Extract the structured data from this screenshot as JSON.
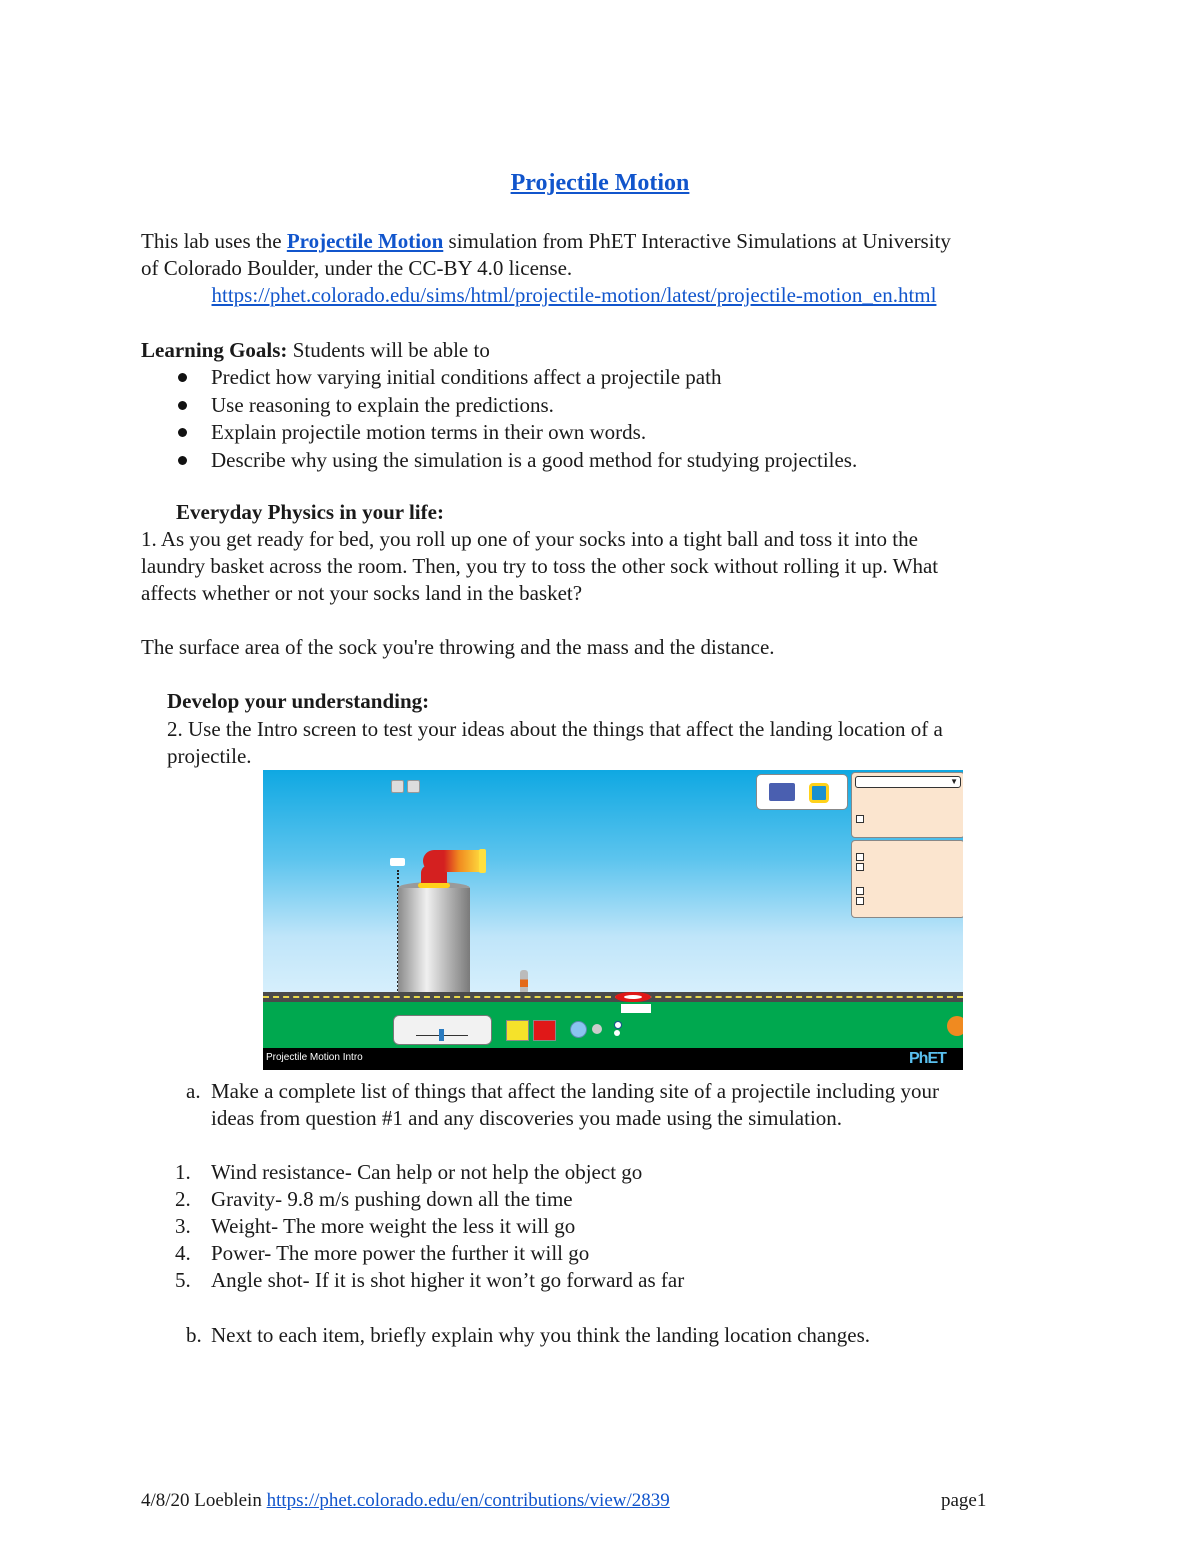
{
  "document": {
    "title": "Projectile Motion",
    "intro": {
      "prefix": "This lab uses the ",
      "link_text": "Projectile Motion",
      "suffix": " simulation from PhET Interactive Simulations at University",
      "line2": "of Colorado Boulder, under the CC-BY 4.0 license.",
      "url": "https://phet.colorado.edu/sims/html/projectile-motion/latest/projectile-motion_en.html"
    },
    "learning_goals": {
      "label": "Learning Goals:",
      "lead": " Students will be able to",
      "items": [
        "Predict how varying initial conditions affect a projectile path",
        "Use reasoning to explain the predictions.",
        "Explain projectile motion terms in their own words.",
        "Describe why using the simulation is a good method for studying projectiles."
      ]
    },
    "everyday": {
      "heading": "Everyday Physics in your life:",
      "question_lines": [
        "1. As you get ready for bed, you roll up one of your socks into a tight ball and toss it into the",
        "laundry basket across the room. Then, you try to toss the other sock without rolling it up. What",
        "affects whether or not your socks land in the basket?"
      ],
      "answer": "The surface area of the sock you're throwing and the mass and the distance."
    },
    "develop": {
      "heading": "Develop your understanding:",
      "question_lines": [
        "2. Use the Intro screen to test your ideas about the things that affect the landing location of a",
        "projectile."
      ]
    },
    "simulation": {
      "footer_label": "Projectile Motion    Intro",
      "logo": "PhET"
    },
    "part_a": {
      "marker": "a.",
      "lines": [
        "Make a complete list of things that affect the landing site of a projectile including your",
        "ideas from question #1 and any discoveries you made using the simulation."
      ]
    },
    "answers": [
      {
        "num": "1.",
        "text": "Wind resistance- Can help or not help the object go"
      },
      {
        "num": "2.",
        "text": "Gravity- 9.8 m/s pushing down all the time"
      },
      {
        "num": "3.",
        "text": "Weight- The more weight the less it will go"
      },
      {
        "num": "4.",
        "text": "Power- The more power the further it will go"
      },
      {
        "num": "5.",
        "text": "Angle shot- If it is shot higher it won’t go forward as far"
      }
    ],
    "part_b": {
      "marker": "b.",
      "text": "Next to each item, briefly explain why you think the landing location changes."
    },
    "footer": {
      "prefix": "4/8/20 Loeblein ",
      "link": "https://phet.colorado.edu/en/contributions/view/2839",
      "page": "page1"
    }
  },
  "colors": {
    "link": "#1155cc",
    "sky": "#5cc4ee",
    "grass": "#00a84f"
  }
}
